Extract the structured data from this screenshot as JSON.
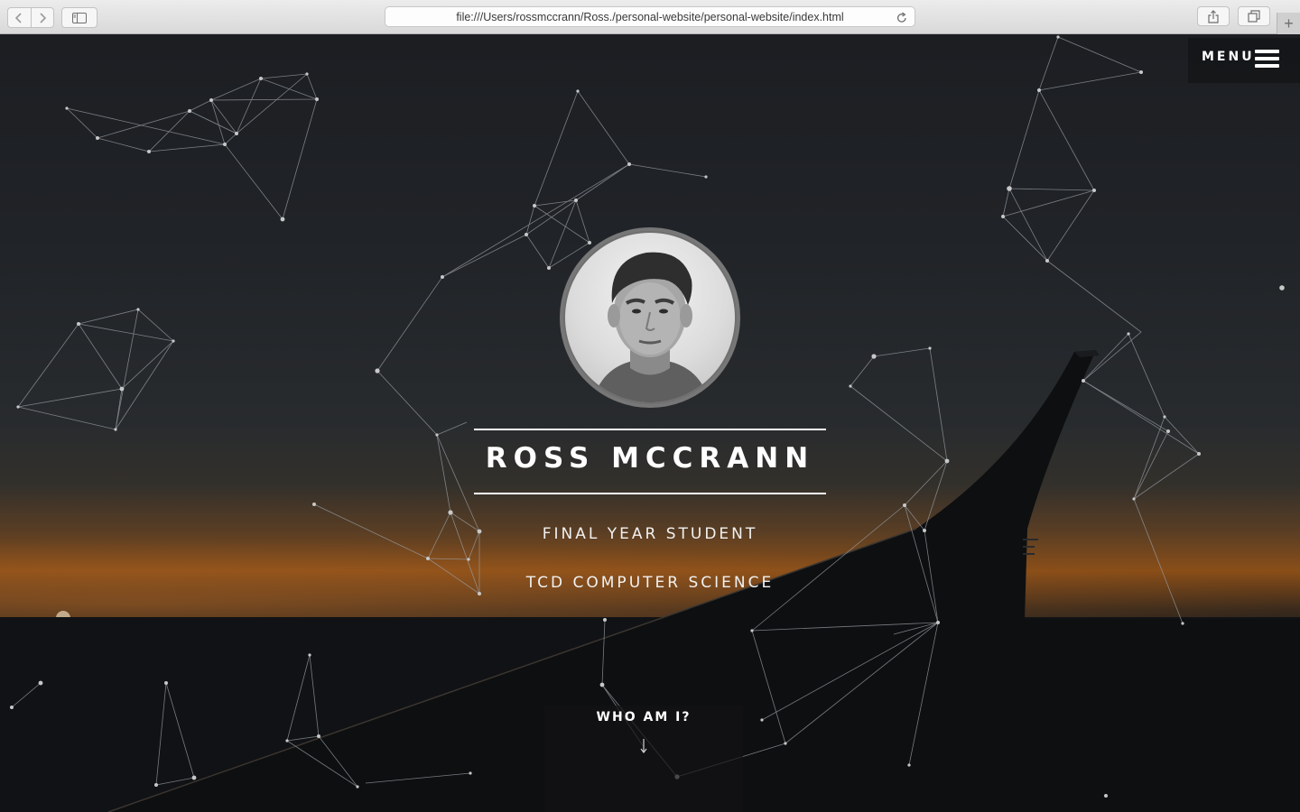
{
  "browser": {
    "url": "file:///Users/rossmccrann/Ross./personal-website/personal-website/index.html",
    "new_tab_label": "+"
  },
  "header": {
    "menu_label": "MENU"
  },
  "hero": {
    "name": "ROSS MCCRANN",
    "subtitle_1": "FINAL YEAR STUDENT",
    "subtitle_2": "TCD COMPUTER SCIENCE",
    "cta_label": "WHO AM I?",
    "avatar_alt": "Profile photo"
  },
  "theme": {
    "text": "#ffffff",
    "network_line": "#9aa0a6",
    "network_node": "#c8c8c8"
  },
  "icons": [
    "back-icon",
    "forward-icon",
    "sidebar-icon",
    "reload-icon",
    "share-icon",
    "tabs-icon",
    "hamburger-icon",
    "chevron-down-icon"
  ]
}
